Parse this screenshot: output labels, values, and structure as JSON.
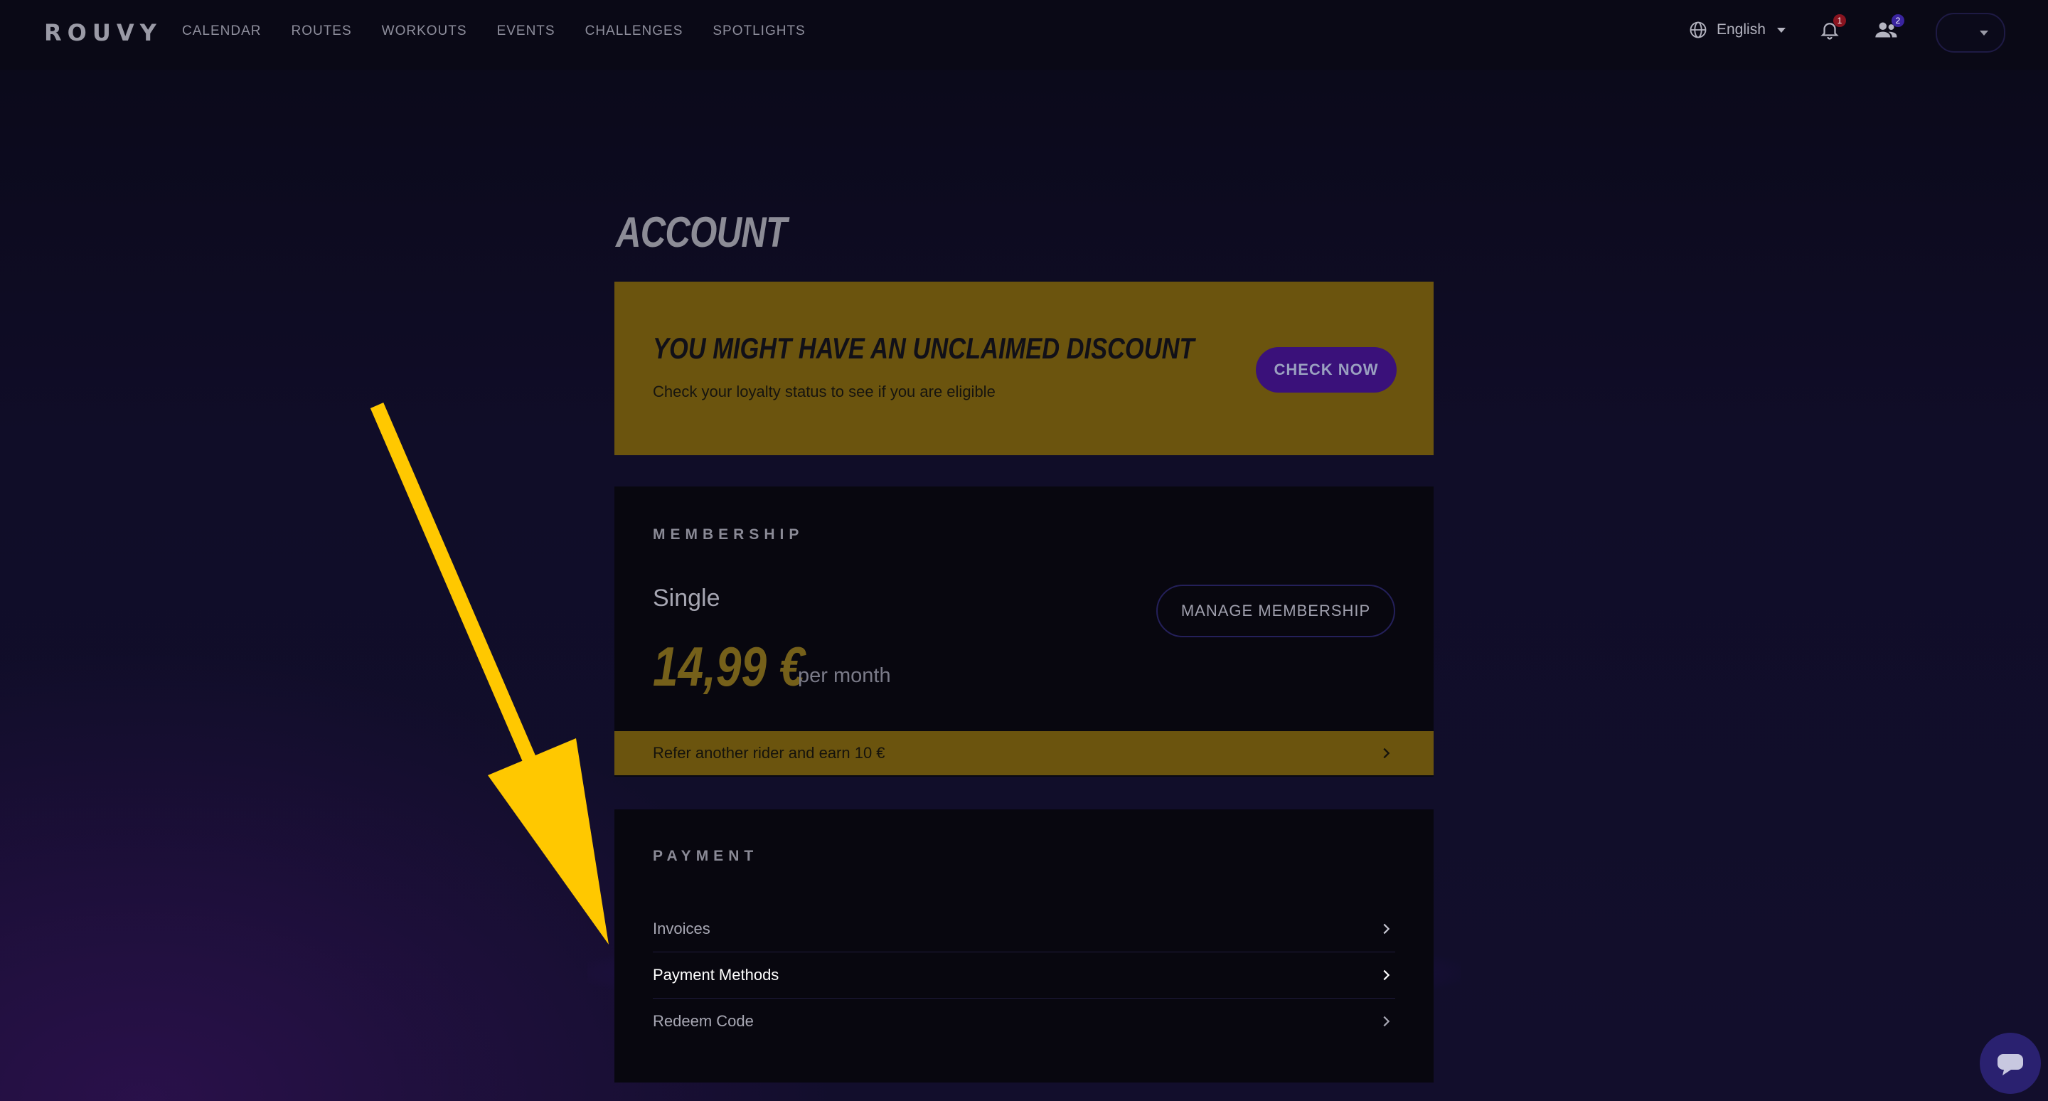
{
  "header": {
    "logo": "ROUVY",
    "nav": [
      "CALENDAR",
      "ROUTES",
      "WORKOUTS",
      "EVENTS",
      "CHALLENGES",
      "SPOTLIGHTS"
    ],
    "language": "English",
    "notifications_count": "1",
    "friends_count": "2"
  },
  "page": {
    "title": "ACCOUNT"
  },
  "promo": {
    "title": "YOU MIGHT HAVE AN UNCLAIMED DISCOUNT",
    "subtitle": "Check your loyalty status to see if you are eligible",
    "button": "CHECK NOW"
  },
  "membership": {
    "section_label": "MEMBERSHIP",
    "plan": "Single",
    "price": "14,99 €",
    "period": "per month",
    "manage_button": "MANAGE MEMBERSHIP",
    "referral": "Refer another rider and earn 10 €"
  },
  "payment": {
    "section_label": "PAYMENT",
    "items": [
      {
        "label": "Invoices"
      },
      {
        "label": "Payment Methods"
      },
      {
        "label": "Redeem Code"
      }
    ]
  },
  "colors": {
    "accent_gold": "#6b540e",
    "accent_purple": "#3a117a",
    "annotation_arrow": "#ffc800"
  }
}
